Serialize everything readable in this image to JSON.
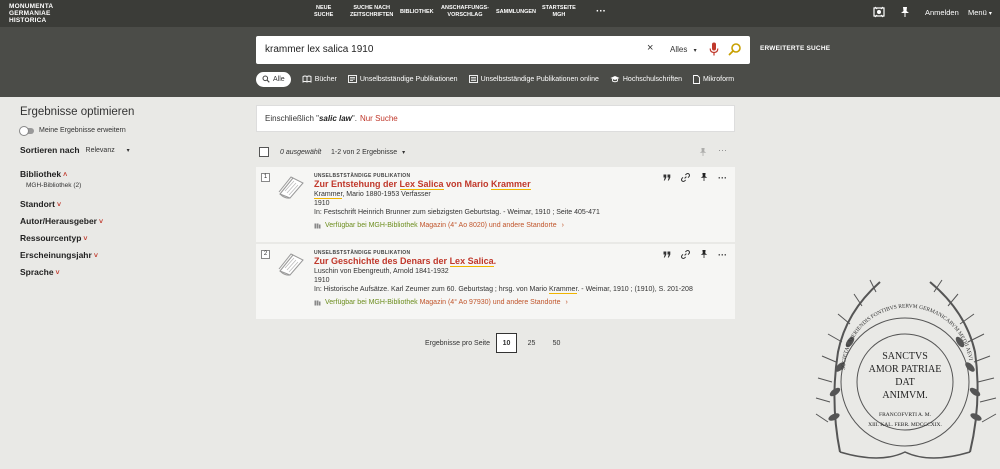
{
  "header": {
    "logo": [
      "MONUMENTA",
      "GERMANIAE",
      "HISTORICA"
    ],
    "nav": [
      {
        "l1": "NEUE",
        "l2": "SUCHE"
      },
      {
        "l1": "SUCHE NACH",
        "l2": "ZEITSCHRIFTEN"
      },
      {
        "l1": "BIBLIOTHEK",
        "l2": ""
      },
      {
        "l1": "ANSCHAFFUNGS-",
        "l2": "VORSCHLAG"
      },
      {
        "l1": "SAMMLUNGEN",
        "l2": ""
      },
      {
        "l1": "STARTSEITE",
        "l2": "MGH"
      }
    ],
    "more": "···",
    "signin": "Anmelden",
    "menu": "Menü"
  },
  "search": {
    "query": "krammer lex salica 1910",
    "clear": "×",
    "scope": "Alles",
    "advanced": "ERWEITERTE SUCHE"
  },
  "filters": [
    {
      "label": "Alle",
      "icon": "search-icon",
      "active": true
    },
    {
      "label": "Bücher",
      "icon": "book-icon"
    },
    {
      "label": "Unselbstständige Publikationen",
      "icon": "article-icon"
    },
    {
      "label": "Unselbstständige Publikationen online",
      "icon": "document-icon"
    },
    {
      "label": "Hochschulschriften",
      "icon": "graduation-cap-icon"
    },
    {
      "label": "Mikroform",
      "icon": "file-icon"
    }
  ],
  "sidebar": {
    "title": "Ergebnisse optimieren",
    "toggle_label": "Meine Ergebnisse erweitern",
    "sort_label": "Sortieren nach",
    "sort_value": "Relevanz",
    "facets": {
      "bibliothek": "Bibliothek",
      "bibliothek_item": "MGH-Bibliothek",
      "bibliothek_count": "(2)",
      "standort": "Standort",
      "autor": "Autor/Herausgeber",
      "ressourcentyp": "Ressourcentyp",
      "erscheinungsjahr": "Erscheinungsjahr",
      "sprache": "Sprache"
    }
  },
  "notice": {
    "prefix": "Einschließlich \"",
    "term": "salic law",
    "suffix": "\".",
    "link": "Nur Suche"
  },
  "results_bar": {
    "selected": "0 ausgewählt",
    "count": "1-2 von 2 Ergebnisse"
  },
  "results": [
    {
      "num": "1",
      "type": "UNSELBSTSTÄNDIGE PUBLIKATION",
      "title_pre": "Zur Entstehung der ",
      "title_hl": "Lex Salica",
      "title_mid": " von Mario ",
      "title_hl2": "Krammer",
      "title_post": "",
      "author_hl": "Krammer",
      "author_post": ", Mario 1880-1953 Verfasser",
      "year": "1910",
      "source_pre": "In: Festschrift Heinrich Brunner zum siebzigsten Geburtstag. - Weimar, 1910 ; Seite 405-471",
      "source_hl": "",
      "source_post": "",
      "avail": "Verfügbar bei MGH-Bibliothek",
      "location": "Magazin (4° Ao 8020) und andere Standorte",
      "arrow": "›"
    },
    {
      "num": "2",
      "type": "UNSELBSTSTÄNDIGE PUBLIKATION",
      "title_pre": "Zur Geschichte des Denars der ",
      "title_hl": "Lex Salica",
      "title_mid": ".",
      "title_hl2": "",
      "title_post": "",
      "author_hl": "",
      "author_post": "Luschin von Ebengreuth, Arnold 1841-1932",
      "year": "1910",
      "source_pre": "In: Historische Aufsätze. Karl Zeumer zum 60. Geburtstag ; hrsg. von Mario ",
      "source_hl": "Krammer",
      "source_post": ". - Weimar, 1910 ; (1910), S. 201-208",
      "avail": "Verfügbar bei MGH-Bibliothek",
      "location": "Magazin (4° Ao 97930) und andere Standorte",
      "arrow": "›"
    }
  ],
  "pager": {
    "label": "Ergebnisse pro Seite",
    "options": [
      "10",
      "25",
      "50"
    ]
  },
  "seal": {
    "center": [
      "SANCTVS",
      "AMOR PATRIAE",
      "DAT",
      "ANIMVM."
    ],
    "ring": "SOCIETAS APERIENDIS FONTIBVS RERVM GERMANICARVM MEDII AEVI",
    "date1": "FRANCOFVRTI A. M.",
    "date2": "XIII. KAL. FEBR. MDCCCXIX."
  },
  "colors": {
    "topbar": "#3b3c38",
    "searchband": "#4b4c48",
    "accent": "#c0382b",
    "available": "#6c8d1d",
    "highlight": "#f0b400"
  }
}
